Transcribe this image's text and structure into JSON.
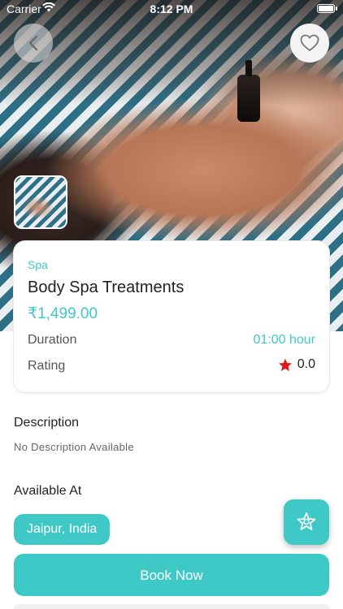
{
  "status_bar": {
    "carrier": "Carrier",
    "time": "8:12 PM",
    "wifi_icon": "wifi-icon",
    "battery_icon": "battery-icon"
  },
  "header": {
    "back_icon": "chevron-left-icon",
    "favorite_icon": "heart-outline-icon"
  },
  "service": {
    "category": "Spa",
    "title": "Body Spa Treatments",
    "price": "₹1,499.00",
    "duration_label": "Duration",
    "duration_value": "01:00 hour",
    "rating_label": "Rating",
    "rating_value": "0.0",
    "rating_icon": "star-icon"
  },
  "description": {
    "heading": "Description",
    "text": "No Description Available"
  },
  "availability": {
    "heading": "Available At",
    "location": "Jaipur, India"
  },
  "actions": {
    "book_label": "Book Now",
    "fab_icon": "star-badge-icon"
  },
  "colors": {
    "accent": "#3ec9c7",
    "star": "#e01b1b"
  }
}
